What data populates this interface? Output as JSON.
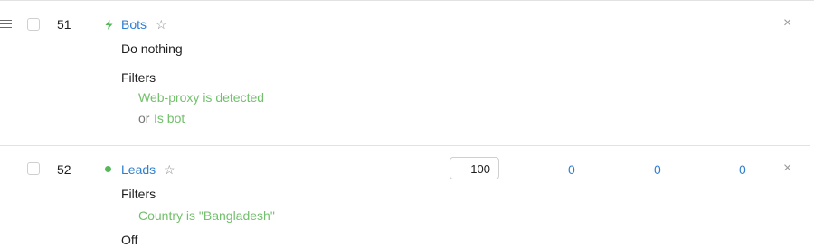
{
  "rows": [
    {
      "number": "51",
      "name": "Bots",
      "status_icon": "lightning-icon",
      "action_text": "Do nothing",
      "filters_label": "Filters",
      "filters": [
        {
          "prefix": "",
          "text": "Web-proxy is detected"
        },
        {
          "prefix": "or",
          "text": "Is bot"
        }
      ],
      "close": "×"
    },
    {
      "number": "52",
      "name": "Leads",
      "status_icon": "green-dot-icon",
      "filters_label": "Filters",
      "filters": [
        {
          "prefix": "",
          "text": "Country is \"Bangladesh\""
        }
      ],
      "weight": "100",
      "stats": [
        "0",
        "0",
        "0"
      ],
      "close": "×",
      "next_label_partial": "Off"
    }
  ],
  "star_glyph": "☆",
  "colors": {
    "link": "#2f7fd0",
    "filter_green": "#72c06c",
    "status_green": "#57b85a"
  }
}
